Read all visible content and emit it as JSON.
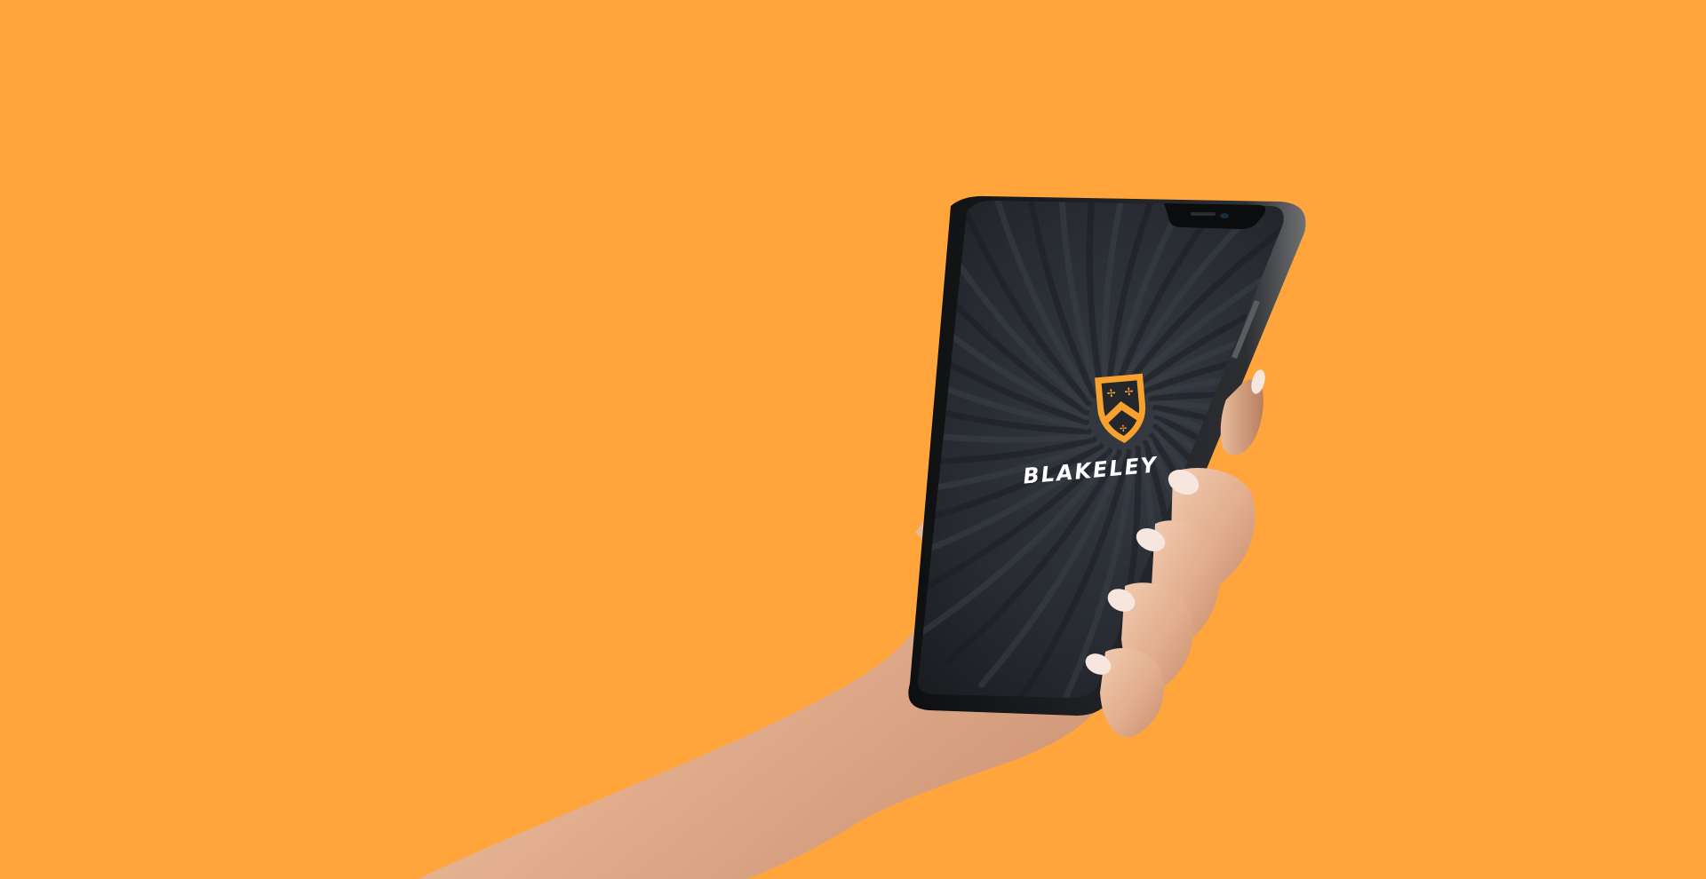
{
  "scene": {
    "background_color": "#FFA53C",
    "device": "smartphone",
    "screen_background": "#23262B",
    "accent_color": "#F7A12E"
  },
  "app": {
    "logo_icon": "shield-crest-icon",
    "brand_name": "BLAKELEY"
  }
}
